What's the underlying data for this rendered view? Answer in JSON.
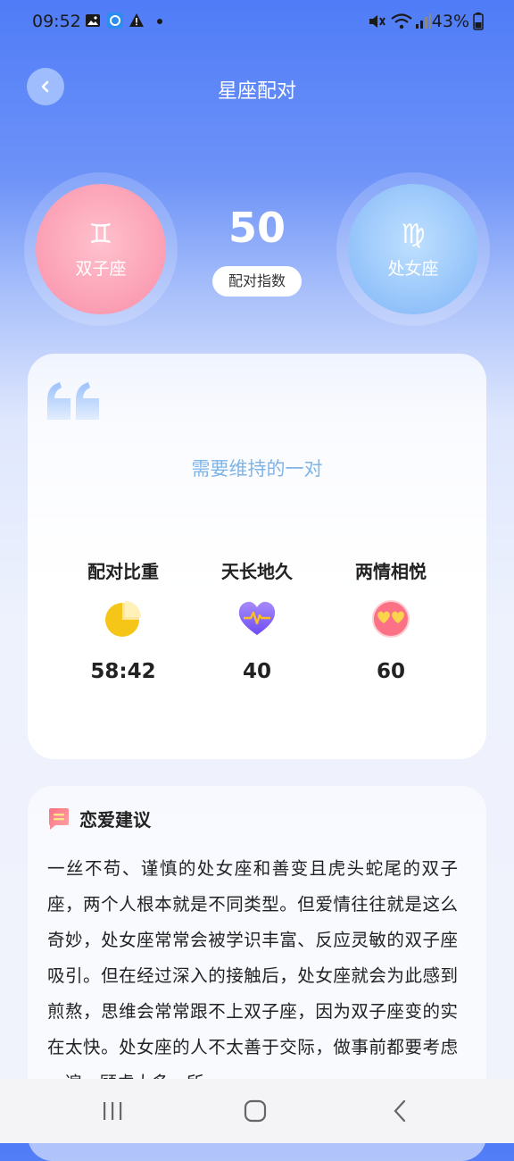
{
  "status_bar": {
    "time": "09:52",
    "battery": "43%"
  },
  "header": {
    "title": "星座配对",
    "back_icon": "chevron-left-icon"
  },
  "match": {
    "left_sign": {
      "symbol": "♊",
      "name": "双子座",
      "color": "#f98fa8"
    },
    "right_sign": {
      "symbol": "♍",
      "name": "处女座",
      "color": "#7fb5f7"
    },
    "score": "50",
    "score_label": "配对指数"
  },
  "summary": {
    "subtitle": "需要维持的一对",
    "metrics": [
      {
        "title": "配对比重",
        "icon": "pie-chart-icon",
        "value": "58:42"
      },
      {
        "title": "天长地久",
        "icon": "heart-pulse-icon",
        "value": "40"
      },
      {
        "title": "两情相悦",
        "icon": "heart-eyes-emoji-icon",
        "value": "60"
      }
    ]
  },
  "advice": {
    "title": "恋爱建议",
    "icon": "chat-bubble-icon",
    "text": "一丝不苟、谨慎的处女座和善变且虎头蛇尾的双子座，两个人根本就是不同类型。但爱情往往就是这么奇妙，处女座常常会被学识丰富、反应灵敏的双子座吸引。但在经过深入的接触后，处女座就会为此感到煎熬，思维会常常跟不上双子座，因为双子座变的实在太快。处女座的人不太善于交际，做事前都要考虑一遍，顾虑太多，所"
  }
}
